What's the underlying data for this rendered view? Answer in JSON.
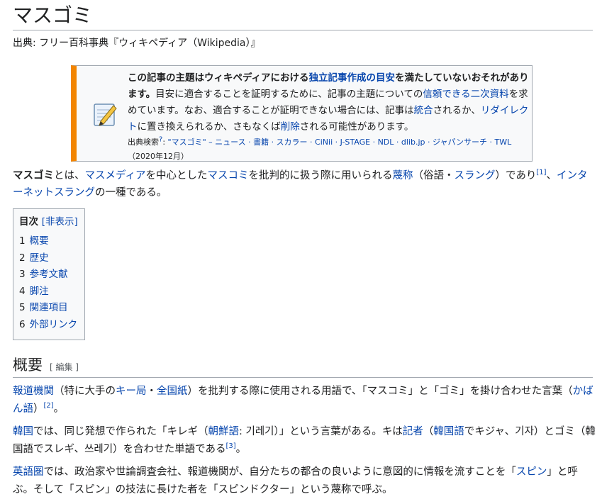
{
  "title": "マスゴミ",
  "source": "出典: フリー百科事典『ウィキペディア（Wikipedia）』",
  "notice": {
    "b1": "この記事の主題はウィキペディアにおける",
    "b_link": "独立記事作成の目安",
    "b2": "を満たしていないおそれがあります。",
    "t1": "目安に適合することを証明するために、記事の主題についての",
    "l1": "信頼できる二次資料",
    "t2": "を求めています。なお、適合することが証明できない場合には、記事は",
    "l2": "統合",
    "t3": "されるか、",
    "l3": "リダイレクト",
    "t4": "に置き換えられるか、さもなくば",
    "l4": "削除",
    "t5": "される可能性があります。",
    "search_label": "出典検索",
    "search_sup": "?",
    "search_links": "\"マスゴミ\" – ニュース · 書籍 · スカラー · CiNii · J-STAGE · NDL · dlib.jp · ジャパンサーチ · TWL",
    "search_date": "（2020年12月）"
  },
  "intro": {
    "term": "マスゴミ",
    "p1": "とは、",
    "l1": "マスメディア",
    "p2": "を中心とした",
    "l2": "マスコミ",
    "p3": "を批判的に扱う際に用いられる",
    "l3": "蔑称",
    "p4": "（俗語・",
    "l4": "スラング",
    "p5": "）であり",
    "ref": "[1]",
    "p6": "、",
    "l5": "インターネットスラング",
    "p7": "の一種である。"
  },
  "toc": {
    "title": "目次",
    "hide": "[非表示]",
    "items": [
      {
        "num": "1",
        "label": "概要"
      },
      {
        "num": "2",
        "label": "歴史"
      },
      {
        "num": "3",
        "label": "参考文献"
      },
      {
        "num": "4",
        "label": "脚注"
      },
      {
        "num": "5",
        "label": "関連項目"
      },
      {
        "num": "6",
        "label": "外部リンク"
      }
    ]
  },
  "section": {
    "title": "概要",
    "edit": "[ 編集 ]"
  },
  "para1": {
    "l1": "報道機関",
    "p1": "（特に大手の",
    "l2": "キー局",
    "p2": "・",
    "l3": "全国紙",
    "p3": "）を批判する際に使用される用語で、「マスコミ」と「ゴミ」を掛け合わせた言葉（",
    "l4": "かばん語",
    "p4": "）",
    "ref": "[2]",
    "p5": "。"
  },
  "para2": {
    "l1": "韓国",
    "p1": "では、同じ発想で作られた「キレギ（",
    "l2": "朝鮮語",
    "p2": ": 기레기）」という言葉がある。キは",
    "l3": "記者",
    "p3": "（",
    "l4": "韓国語",
    "p4": "でキジャ、기자）とゴミ（韓国語でスレギ、쓰레기）を合わせた単語である",
    "ref": "[3]",
    "p5": "。"
  },
  "para3": {
    "l1": "英語圏",
    "p1": "では、政治家や世論調査会社、報道機関が、自分たちの都合の良いように意図的に情報を流すことを「",
    "l2": "スピン",
    "p2": "」と呼ぶ。そして「スピン」の技法に長けた者を「スピンドクター」という蔑称で呼ぶ。"
  }
}
